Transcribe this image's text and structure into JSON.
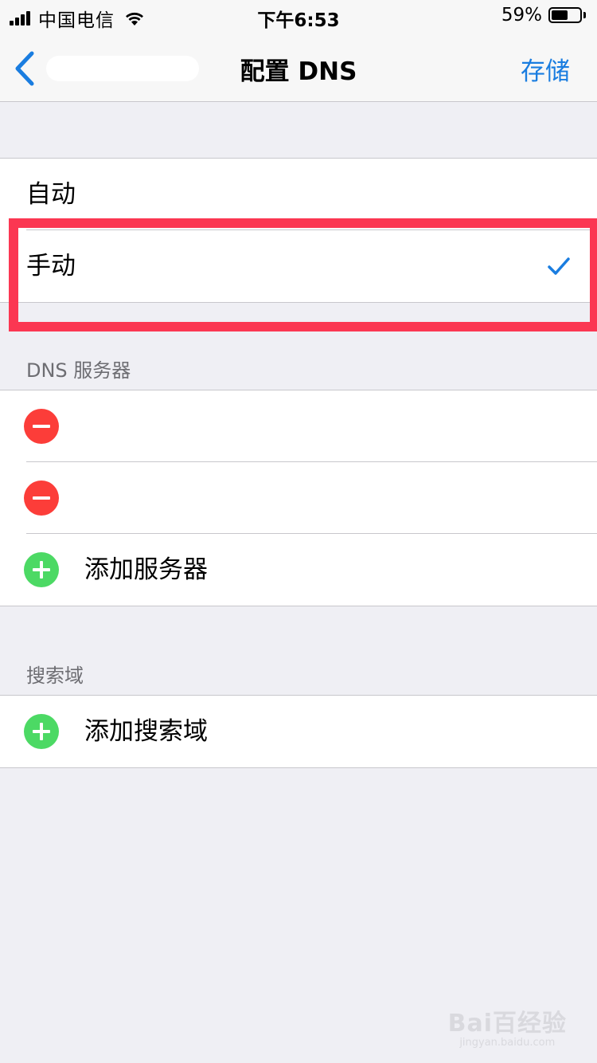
{
  "status_bar": {
    "carrier": "中国电信",
    "time": "下午6:53",
    "battery_percent": "59%",
    "battery_level": 0.59
  },
  "nav": {
    "back_icon": "chevron-left-icon",
    "title": "配置 DNS",
    "save_label": "存储",
    "accent_color": "#1a7de0"
  },
  "mode_options": [
    {
      "label": "自动",
      "selected": false
    },
    {
      "label": "手动",
      "selected": true
    }
  ],
  "dns_section": {
    "header": "DNS 服务器",
    "servers": [
      "",
      ""
    ],
    "add_label": "添加服务器"
  },
  "search_section": {
    "header": "搜索域",
    "add_label": "添加搜索域"
  },
  "colors": {
    "delete": "#fc3d39",
    "add": "#4cd964",
    "highlight": "#fb3752"
  },
  "watermark": {
    "brand": "Bai百经验",
    "url": "jingyan.baidu.com"
  }
}
